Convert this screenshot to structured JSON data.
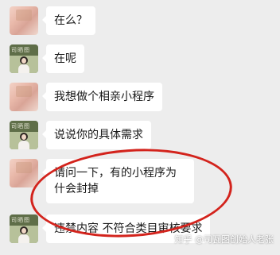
{
  "messages": [
    {
      "text": "在么？",
      "avatar": "blurred-avatar"
    },
    {
      "text": "在呢",
      "avatar": "photo-avatar"
    },
    {
      "text": "我想做个相亲小程序",
      "avatar": "blurred-avatar"
    },
    {
      "text": "说说你的具体需求",
      "avatar": "photo-avatar"
    },
    {
      "text": "请问一下，有的小程序为什会封掉",
      "avatar": "blurred-avatar"
    },
    {
      "text": "违禁内容 不符合类目审核要求",
      "avatar": "photo-avatar"
    }
  ],
  "watermark": "知乎 @司瓦图创始人老张",
  "highlight_color": "#d3231c"
}
